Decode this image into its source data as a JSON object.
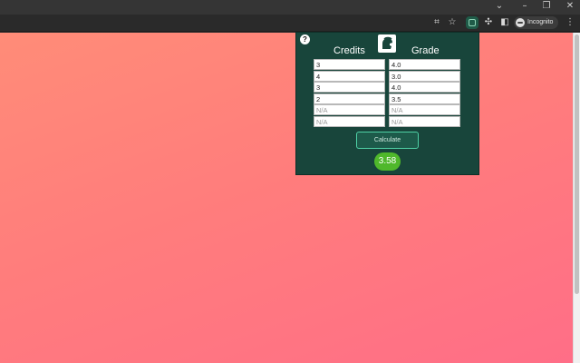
{
  "window_controls": {
    "chevron": "⌄",
    "minimize": "–",
    "restore": "❐",
    "close": "✕"
  },
  "toolbar": {
    "icons": [
      "qr-code-icon",
      "star-icon",
      "gpa-extension-icon",
      "puzzle-icon",
      "sidebar-icon",
      "kebab-menu-icon"
    ],
    "star_glyph": "☆",
    "puzzle_glyph": "✣",
    "sidebar_glyph": "◧",
    "menu_glyph": "⋮",
    "qr_glyph": "⌗",
    "incognito_label": "Incognito"
  },
  "page": {
    "gradient_start": "#ff8c78",
    "gradient_end": "#ff6e87"
  },
  "popup": {
    "help_label": "?",
    "credits_header": "Credits",
    "grade_header": "Grade",
    "logo": "spartan-helmet-icon",
    "rows": [
      {
        "credits": "3",
        "grade": "4.0",
        "placeholder": false
      },
      {
        "credits": "4",
        "grade": "3.0",
        "placeholder": false
      },
      {
        "credits": "3",
        "grade": "4.0",
        "placeholder": false
      },
      {
        "credits": "2",
        "grade": "3.5",
        "placeholder": false
      },
      {
        "credits": "N/A",
        "grade": "N/A",
        "placeholder": true
      },
      {
        "credits": "N/A",
        "grade": "N/A",
        "placeholder": true
      }
    ],
    "calculate_label": "Calculate",
    "result": "3.58",
    "colors": {
      "background": "#18453b",
      "button_border": "#4fd1a6",
      "result_badge": "#4fb82b"
    }
  }
}
